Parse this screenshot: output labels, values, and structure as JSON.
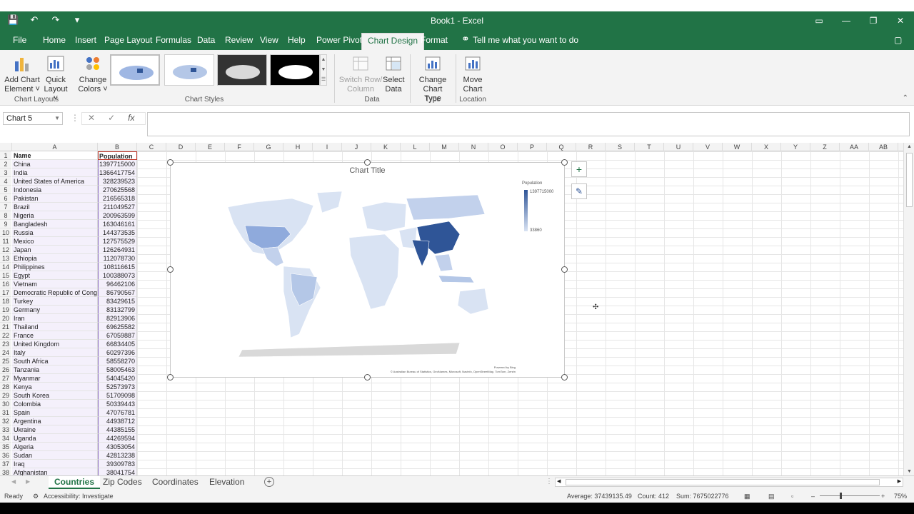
{
  "window": {
    "title": "Book1  -  Excel"
  },
  "tabs": [
    "File",
    "Home",
    "Insert",
    "Page Layout",
    "Formulas",
    "Data",
    "Review",
    "View",
    "Help",
    "Power Pivot",
    "Chart Design",
    "Format"
  ],
  "active_tab": "Chart Design",
  "tell_me": "Tell me what you want to do",
  "ribbon": {
    "add_chart_element": "Add Chart Element",
    "quick_layout": "Quick Layout",
    "change_colors": "Change Colors",
    "switch_row_column": "Switch Row/ Column",
    "select_data": "Select Data",
    "change_chart_type": "Change Chart Type",
    "move_chart": "Move Chart",
    "groups": {
      "chart_layouts": "Chart Layouts",
      "chart_styles": "Chart Styles",
      "data": "Data",
      "type": "Type",
      "location": "Location"
    }
  },
  "name_box": "Chart 5",
  "formula": "",
  "columns": [
    "A",
    "B",
    "C",
    "D",
    "E",
    "F",
    "G",
    "H",
    "I",
    "J",
    "K",
    "L",
    "M",
    "N",
    "O",
    "P",
    "Q",
    "R",
    "S",
    "T",
    "U",
    "V",
    "W",
    "X",
    "Y",
    "Z",
    "AA",
    "AB"
  ],
  "table": {
    "headers": [
      "Name",
      "Population"
    ],
    "rows": [
      [
        "China",
        "1397715000"
      ],
      [
        "India",
        "1366417754"
      ],
      [
        "United States of America",
        "328239523"
      ],
      [
        "Indonesia",
        "270625568"
      ],
      [
        "Pakistan",
        "216565318"
      ],
      [
        "Brazil",
        "211049527"
      ],
      [
        "Nigeria",
        "200963599"
      ],
      [
        "Bangladesh",
        "163046161"
      ],
      [
        "Russia",
        "144373535"
      ],
      [
        "Mexico",
        "127575529"
      ],
      [
        "Japan",
        "126264931"
      ],
      [
        "Ethiopia",
        "112078730"
      ],
      [
        "Philippines",
        "108116615"
      ],
      [
        "Egypt",
        "100388073"
      ],
      [
        "Vietnam",
        "96462106"
      ],
      [
        "Democratic Republic of Congo",
        "86790567"
      ],
      [
        "Turkey",
        "83429615"
      ],
      [
        "Germany",
        "83132799"
      ],
      [
        "Iran",
        "82913906"
      ],
      [
        "Thailand",
        "69625582"
      ],
      [
        "France",
        "67059887"
      ],
      [
        "United Kingdom",
        "66834405"
      ],
      [
        "Italy",
        "60297396"
      ],
      [
        "South Africa",
        "58558270"
      ],
      [
        "Tanzania",
        "58005463"
      ],
      [
        "Myanmar",
        "54045420"
      ],
      [
        "Kenya",
        "52573973"
      ],
      [
        "South Korea",
        "51709098"
      ],
      [
        "Colombia",
        "50339443"
      ],
      [
        "Spain",
        "47076781"
      ],
      [
        "Argentina",
        "44938712"
      ],
      [
        "Ukraine",
        "44385155"
      ],
      [
        "Uganda",
        "44269594"
      ],
      [
        "Algeria",
        "43053054"
      ],
      [
        "Sudan",
        "42813238"
      ],
      [
        "Iraq",
        "39309783"
      ],
      [
        "Afghanistan",
        "38041754"
      ]
    ]
  },
  "chart": {
    "title": "Chart Title",
    "legend_title": "Population",
    "legend_max": "1397715000",
    "legend_min": "33860",
    "powered_by": "Powered by Bing",
    "credits": "© Australian Bureau of Statistics, GeoNames, Microsoft, Navinfo, OpenStreetMap, TomTom, Zenrin",
    "colors": {
      "high": "#2f5597",
      "mid": "#8faadc",
      "low": "#d9e3f3",
      "antarctica": "#d9d9d9"
    }
  },
  "sheets": [
    "Countries",
    "Zip Codes",
    "Coordinates",
    "Elevation"
  ],
  "active_sheet": "Countries",
  "status": {
    "ready": "Ready",
    "accessibility": "Accessibility: Investigate",
    "average": "Average: 37439135.49",
    "count": "Count: 412",
    "sum": "Sum: 7675022776",
    "zoom": "75%"
  }
}
